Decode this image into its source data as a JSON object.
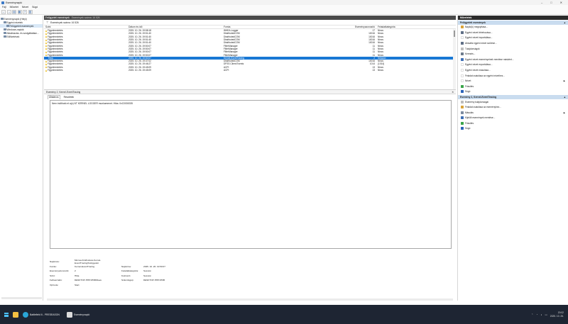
{
  "window": {
    "title": "Eseménynapló"
  },
  "menu": [
    "Fájl",
    "Művelet",
    "Nézet",
    "Súgó"
  ],
  "tree": {
    "items": [
      {
        "label": "Eseménynapló (Helyi)",
        "indent": 0,
        "selected": false
      },
      {
        "label": "Egyéni nézetek",
        "indent": 1,
        "selected": false
      },
      {
        "label": "Felügyeleti események",
        "indent": 2,
        "selected": true
      },
      {
        "label": "Windows-naplók",
        "indent": 1,
        "selected": false
      },
      {
        "label": "Alkalmazás- és szolgáltatásn…",
        "indent": 1,
        "selected": false
      },
      {
        "label": "Előfizetések",
        "indent": 1,
        "selected": false
      }
    ]
  },
  "pane": {
    "title": "Felügyeleti események",
    "count": "Események száma: 16 526",
    "filter": "Események száma: 16 526"
  },
  "grid": {
    "headers": {
      "level": "Szint",
      "date": "Dátum és idő",
      "source": "Forrás",
      "id": "Eseményazonosító",
      "category": "Feladatkategória"
    },
    "rows": [
      {
        "level": "Figyelmeztetés",
        "icon": "warning",
        "date": "2025. 10. 26. 19:58:18",
        "source": "WHEA-Logger",
        "id": "17",
        "category": "Nincs"
      },
      {
        "level": "Figyelmeztetés",
        "icon": "warning",
        "date": "2025. 10. 26. 19:51:40",
        "source": "DistributedCOM",
        "id": "10016",
        "category": "Nincs"
      },
      {
        "level": "Figyelmeztetés",
        "icon": "warning",
        "date": "2025. 10. 26. 19:51:40",
        "source": "DistributedCOM",
        "id": "10016",
        "category": "Nincs"
      },
      {
        "level": "Figyelmeztetés",
        "icon": "warning",
        "date": "2025. 10. 26. 19:51:40",
        "source": "DistributedCOM",
        "id": "10016",
        "category": "Nincs"
      },
      {
        "level": "Figyelmeztetés",
        "icon": "warning",
        "date": "2025. 10. 26. 19:51:40",
        "source": "DistributedCOM",
        "id": "10016",
        "category": "Nincs"
      },
      {
        "level": "Figyelmeztetés",
        "icon": "warning",
        "date": "2025. 10. 26. 19:50:07",
        "source": "FilterManager",
        "id": "11",
        "category": "Nincs"
      },
      {
        "level": "Figyelmeztetés",
        "icon": "warning",
        "date": "2025. 10. 26. 19:50:07",
        "source": "FilterManager",
        "id": "11",
        "category": "Nincs"
      },
      {
        "level": "Figyelmeztetés",
        "icon": "warning",
        "date": "2025. 10. 26. 19:50:07",
        "source": "FilterManager",
        "id": "11",
        "category": "Nincs"
      },
      {
        "level": "Figyelmeztetés",
        "icon": "warning",
        "date": "2025. 10. 26. 19:50:07",
        "source": "FilterManager",
        "id": "11",
        "category": "Nincs"
      },
      {
        "level": "Hiba",
        "icon": "error",
        "date": "2025. 10. 26. 19:50:07",
        "source": "Kernel-EventTracing",
        "id": "2",
        "category": "Session",
        "selected": true
      },
      {
        "level": "Figyelmeztetés",
        "icon": "warning",
        "date": "2025. 10. 26. 19:47:02",
        "source": "DistributedCOM",
        "id": "10016",
        "category": "Nincs"
      },
      {
        "level": "Figyelmeztetés",
        "icon": "warning",
        "date": "2025. 10. 26. 19:46:27",
        "source": "DFSS Client Events",
        "id": "1014",
        "category": "(1014)"
      },
      {
        "level": "Figyelmeztetés",
        "icon": "warning",
        "date": "2025. 10. 26. 19:45:09",
        "source": "ACPI",
        "id": "13",
        "category": "Nincs"
      },
      {
        "level": "Figyelmeztetés",
        "icon": "warning",
        "date": "2025. 10. 26. 19:45:09",
        "source": "ACPI",
        "id": "13",
        "category": "Nincs"
      }
    ]
  },
  "detail": {
    "title": "Esemény 2, Kernel-EventTracing",
    "tabs": [
      "Általános",
      "Részletek"
    ],
    "description": "Nem indítható el a(z) NT KERNEL LOGGER munkamenet. Hiba: 0xC0000035",
    "props": [
      {
        "l1": "Naplónév:",
        "v1": "Microsoft-Windows-Kernel-EventTracing/Felügyeleti",
        "l2": "",
        "v2": ""
      },
      {
        "l1": "Forrás:",
        "v1": "Kernel-EventTracing",
        "l2": "Naplózva:",
        "v2": "2025. 10. 26. 19:50:07"
      },
      {
        "l1": "Eseményazonosító:",
        "v1": "2",
        "l2": "Feladatkategória:",
        "v2": "Session"
      },
      {
        "l1": "Szint:",
        "v1": "Hiba",
        "l2": "Kulcsszó:",
        "v2": "Session"
      },
      {
        "l1": "Felhasználó:",
        "v1": "DESKTOP-HHP1H6B\\Dave",
        "l2": "Számítógép:",
        "v2": "DESKTOP-HHP1H6B"
      },
      {
        "l1": "OpCode:",
        "v1": "Start",
        "l2": "",
        "v2": ""
      }
    ]
  },
  "actions": {
    "header": "Műveletek",
    "group1": {
      "title": "Felügyeleti események",
      "items": [
        {
          "label": "Napló(k) megnyitása...",
          "icon": "open",
          "color": "#d9a33a"
        },
        {
          "label": "Egyéni nézet létrehozása...",
          "icon": "filter",
          "color": "#5f6f86"
        },
        {
          "label": "Egyéni nézet importálása...",
          "icon": "import",
          "color": "#ffffff"
        },
        {
          "label": "Aktuális egyéni nézet szűrése...",
          "icon": "filter",
          "color": "#5f6f86"
        },
        {
          "label": "Tulajdonságok",
          "icon": "properties",
          "color": "#bcbcbc"
        },
        {
          "label": "Keresés...",
          "icon": "find",
          "color": "#6d7b8c"
        },
        {
          "label": "Egyéni nézet eseményeinek mentése másként...",
          "icon": "save",
          "color": "#3f6fb5"
        },
        {
          "label": "Egyéni nézet exportálása...",
          "icon": "export",
          "color": "#ffffff"
        },
        {
          "label": "Egyéni nézet másolása...",
          "icon": "copy",
          "color": "#ffffff"
        },
        {
          "label": "Feladat csatolása az egyéni nézethez...",
          "icon": "attach",
          "color": "#ffffff"
        },
        {
          "label": "Nézet",
          "icon": "view",
          "color": "#ffffff",
          "arrow": true
        },
        {
          "label": "Frissítés",
          "icon": "refresh",
          "color": "#3aa54a"
        },
        {
          "label": "Súgó",
          "icon": "help",
          "color": "#2b63b8"
        }
      ]
    },
    "group2": {
      "title": "Esemény 2, Kernel-EventTracing",
      "items": [
        {
          "label": "Esemény tulajdonságai",
          "icon": "properties",
          "color": "#bcbcbc"
        },
        {
          "label": "Feladat csatolása az eseményhez...",
          "icon": "attach",
          "color": "#d9a33a"
        },
        {
          "label": "Másolás",
          "icon": "copy",
          "color": "#7d8ba0",
          "arrow": true
        },
        {
          "label": "Kijelölt események mentése...",
          "icon": "save",
          "color": "#3f6fb5"
        },
        {
          "label": "Frissítés",
          "icon": "refresh",
          "color": "#3aa54a"
        },
        {
          "label": "Súgó",
          "icon": "help",
          "color": "#2b63b8"
        }
      ]
    }
  },
  "taskbar": {
    "apps": [
      {
        "label": "",
        "color": "#f5c042",
        "name": "file-explorer"
      },
      {
        "label": "Battlefield 6 - PRESEASON",
        "color": "#2aa5d6",
        "name": "browser"
      },
      {
        "label": "Eseménynapló",
        "color": "#dcdcdc",
        "name": "event-viewer"
      }
    ],
    "clock_time": "20:02",
    "clock_date": "2025. 10. 26."
  }
}
